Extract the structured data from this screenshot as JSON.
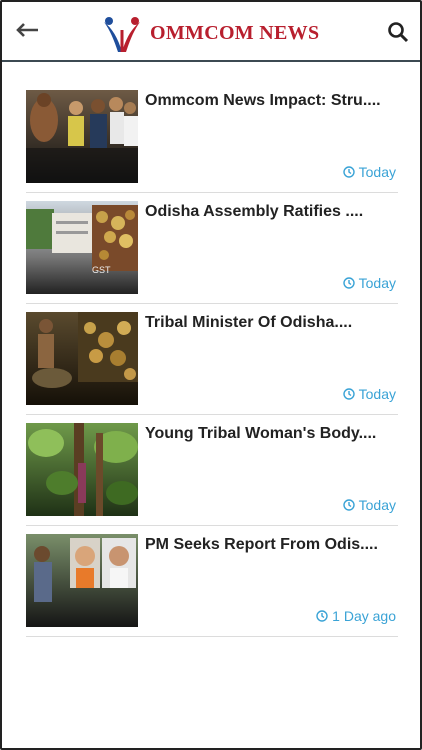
{
  "header": {
    "brand": "OMMCOM NEWS",
    "back_icon": "arrow-left-icon",
    "search_icon": "search-icon"
  },
  "colors": {
    "brand_red": "#b81f2e",
    "brand_blue": "#1f4e9c",
    "timestamp": "#3aa3d6"
  },
  "articles": [
    {
      "title": "Ommcom News Impact: Stru....",
      "time": "Today"
    },
    {
      "title": "Odisha Assembly Ratifies ....",
      "time": "Today"
    },
    {
      "title": "Tribal Minister Of Odisha....",
      "time": "Today"
    },
    {
      "title": "Young Tribal Woman's Body....",
      "time": "Today"
    },
    {
      "title": "PM Seeks Report From Odis....",
      "time": "1 Day ago"
    }
  ],
  "thumb_labels": {
    "gst": "GST"
  }
}
